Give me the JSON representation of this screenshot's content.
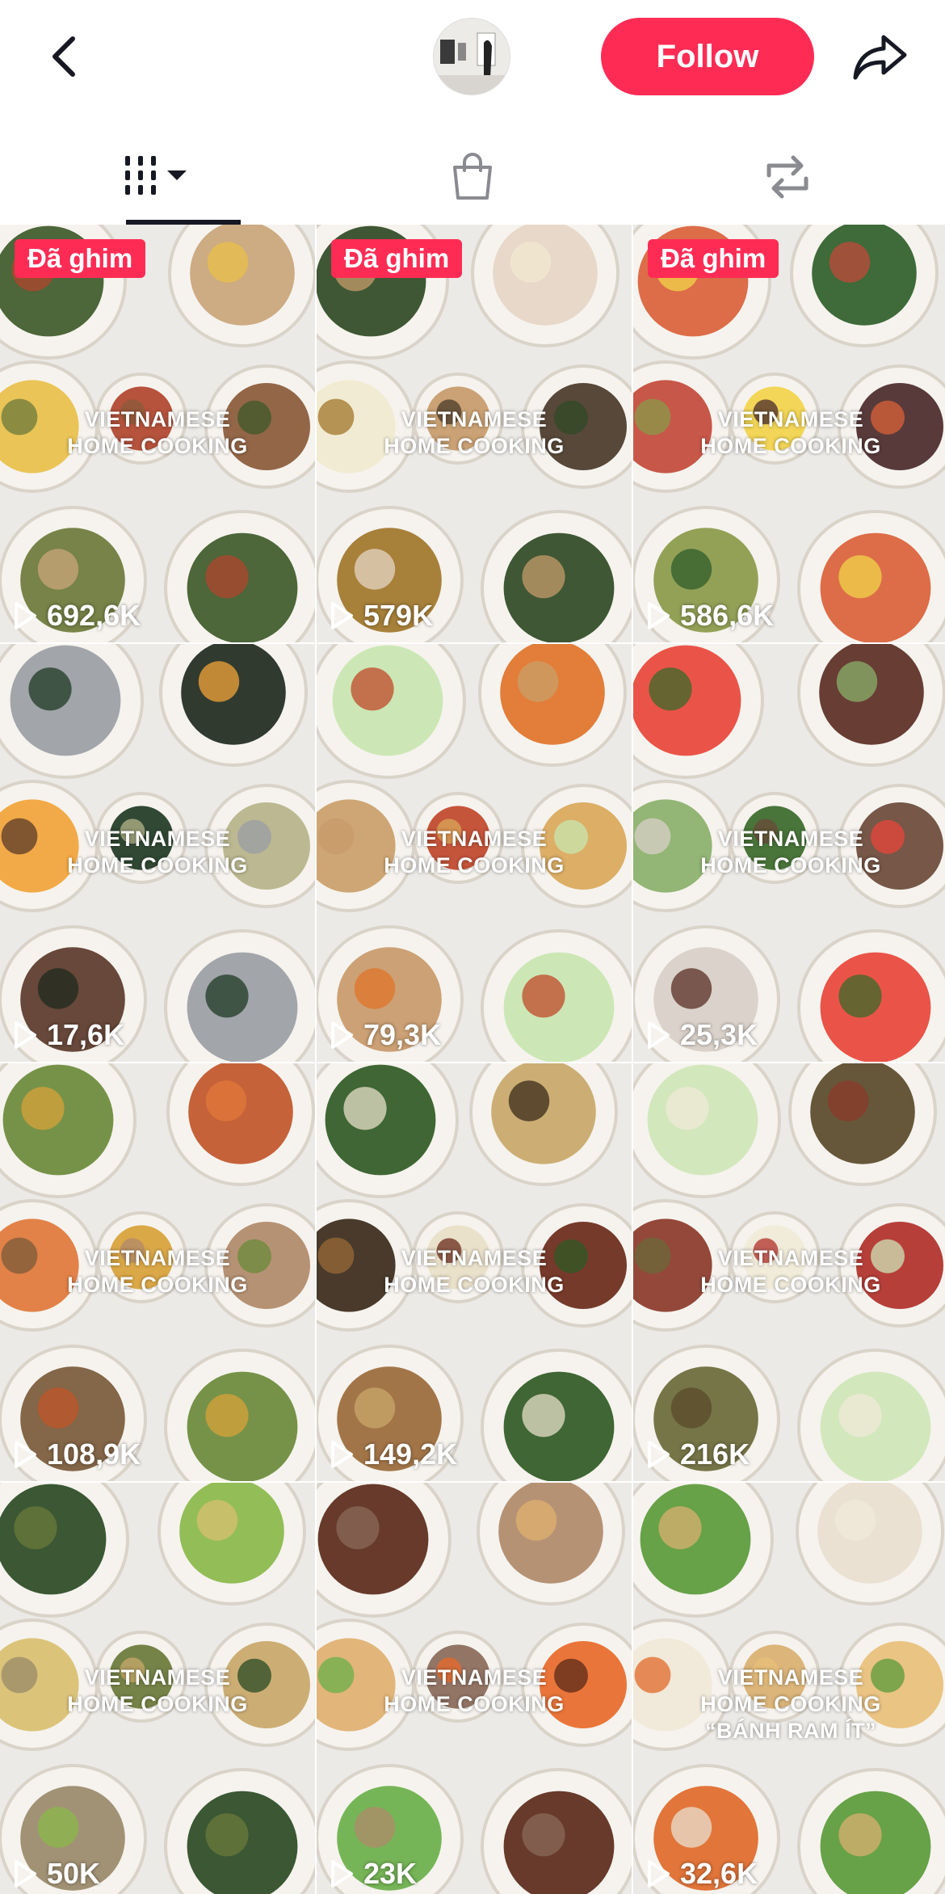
{
  "header": {
    "back_icon": "chevron-left-icon",
    "follow_label": "Follow",
    "share_icon": "share-arrow-icon",
    "follow_color": "#fe2c55"
  },
  "tabs": [
    {
      "icon": "videos-grid-icon",
      "active": true
    },
    {
      "icon": "shopping-bag-icon",
      "active": false
    },
    {
      "icon": "repost-icon",
      "active": false
    }
  ],
  "grid": {
    "items": [
      {
        "pinned": "Đã ghim",
        "caption1": "VIETNAMESE",
        "caption2": "HOME COOKING",
        "caption3": "",
        "views": "692,6K"
      },
      {
        "pinned": "Đã ghim",
        "caption1": "VIETNAMESE",
        "caption2": "HOME COOKING",
        "caption3": "",
        "views": "579K"
      },
      {
        "pinned": "Đã ghim",
        "caption1": "VIETNAMESE",
        "caption2": "HOME COOKING",
        "caption3": "",
        "views": "586,6K"
      },
      {
        "pinned": "",
        "caption1": "VIETNAMESE",
        "caption2": "HOME COOKING",
        "caption3": "",
        "views": "17,6K"
      },
      {
        "pinned": "",
        "caption1": "VIETNAMESE",
        "caption2": "HOME COOKING",
        "caption3": "",
        "views": "79,3K"
      },
      {
        "pinned": "",
        "caption1": "VIETNAMESE",
        "caption2": "HOME COOKING",
        "caption3": "",
        "views": "25,3K"
      },
      {
        "pinned": "",
        "caption1": "VIETNAMESE",
        "caption2": "HOME COOKING",
        "caption3": "",
        "views": "108,9K"
      },
      {
        "pinned": "",
        "caption1": "VIETNAMESE",
        "caption2": "HOME COOKING",
        "caption3": "",
        "views": "149,2K"
      },
      {
        "pinned": "",
        "caption1": "VIETNAMESE",
        "caption2": "HOME COOKING",
        "caption3": "",
        "views": "216K"
      },
      {
        "pinned": "",
        "caption1": "VIETNAMESE",
        "caption2": "HOME COOKING",
        "caption3": "",
        "views": "50K"
      },
      {
        "pinned": "",
        "caption1": "VIETNAMESE",
        "caption2": "HOME COOKING",
        "caption3": "",
        "views": "23K"
      },
      {
        "pinned": "",
        "caption1": "VIETNAMESE",
        "caption2": "HOME COOKING",
        "caption3": "“BÁNH RAM ÍT”",
        "views": "32,6K"
      }
    ]
  }
}
